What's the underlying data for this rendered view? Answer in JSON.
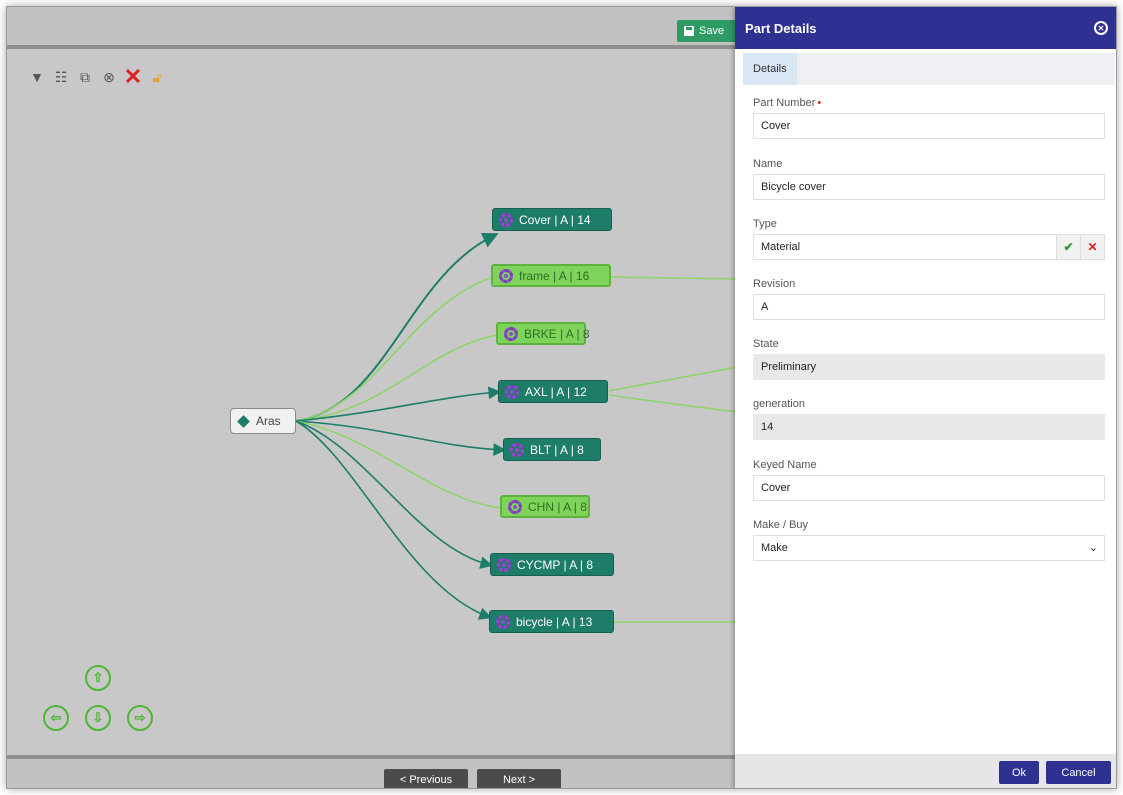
{
  "toolbar": {
    "save_label": "Save",
    "icons": [
      "filter-icon",
      "list-icon",
      "open-icon",
      "link-icon",
      "delete-icon",
      "lock-icon"
    ]
  },
  "graph": {
    "root": "Aras",
    "nodes": [
      {
        "label": "Cover | A | 14",
        "style": "dark"
      },
      {
        "label": "frame | A | 16",
        "style": "light"
      },
      {
        "label": "BRKE | A | 8",
        "style": "light"
      },
      {
        "label": "AXL | A | 12",
        "style": "dark"
      },
      {
        "label": "BLT | A | 8",
        "style": "dark"
      },
      {
        "label": "CHN | A | 8",
        "style": "light"
      },
      {
        "label": "CYCMP | A | 8",
        "style": "dark"
      },
      {
        "label": "bicycle | A | 13",
        "style": "dark"
      }
    ]
  },
  "pager": {
    "previous": "< Previous",
    "next": "Next >"
  },
  "panel": {
    "title": "Part Details",
    "tab": "Details",
    "fields": {
      "part_number": {
        "label": "Part Number",
        "value": "Cover"
      },
      "name": {
        "label": "Name",
        "value": "Bicycle cover"
      },
      "type": {
        "label": "Type",
        "value": "Material"
      },
      "revision": {
        "label": "Revision",
        "value": "A"
      },
      "state": {
        "label": "State",
        "value": "Preliminary"
      },
      "generation": {
        "label": "generation",
        "value": "14"
      },
      "keyed_name": {
        "label": "Keyed Name",
        "value": "Cover"
      },
      "make_buy": {
        "label": "Make / Buy",
        "value": "Make"
      }
    },
    "ok": "Ok",
    "cancel": "Cancel"
  },
  "colors": {
    "panel_header": "#2e3192",
    "node_dark": "#1e7d68",
    "node_light": "#7ed35a",
    "save_green": "#2e9b64"
  }
}
